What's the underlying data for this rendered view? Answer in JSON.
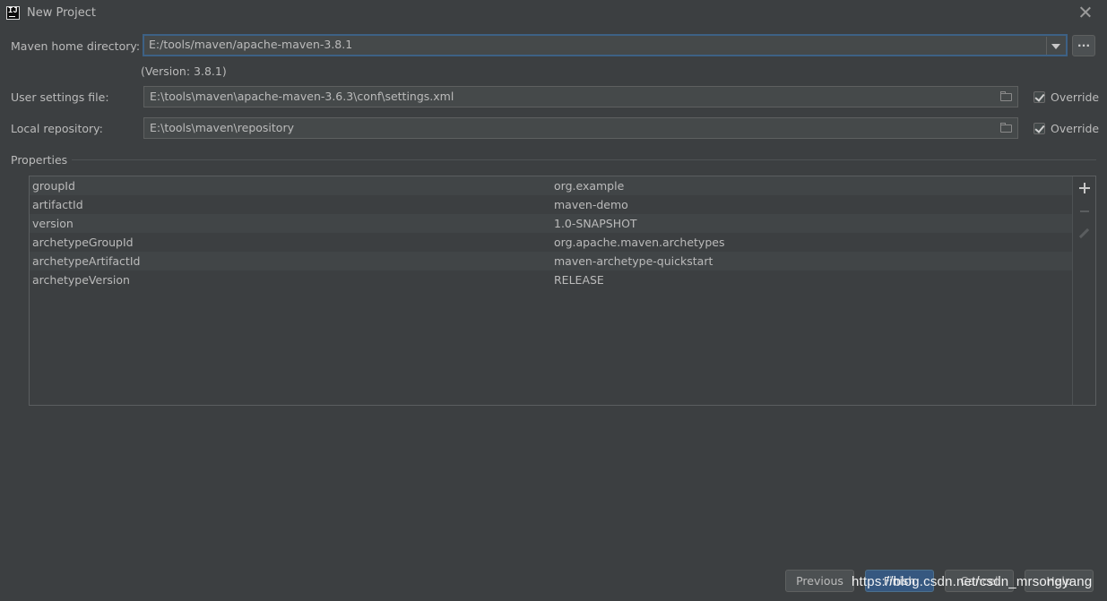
{
  "window": {
    "title": "New Project",
    "icon": "intellij-icon",
    "app_icon_text": "IJ"
  },
  "maven_home": {
    "label": "Maven home directory:",
    "value": "E:/tools/maven/apache-maven-3.8.1",
    "version_note": "(Version: 3.8.1)",
    "browse_label": "..."
  },
  "user_settings": {
    "label": "User settings file:",
    "value": "E:\\tools\\maven\\apache-maven-3.6.3\\conf\\settings.xml",
    "override_label": "Override",
    "override_checked": true
  },
  "local_repository": {
    "label": "Local repository:",
    "value": "E:\\tools\\maven\\repository",
    "override_label": "Override",
    "override_checked": true
  },
  "properties": {
    "header": "Properties",
    "rows": [
      {
        "key": "groupId",
        "value": "org.example"
      },
      {
        "key": "artifactId",
        "value": "maven-demo"
      },
      {
        "key": "version",
        "value": "1.0-SNAPSHOT"
      },
      {
        "key": "archetypeGroupId",
        "value": "org.apache.maven.archetypes"
      },
      {
        "key": "archetypeArtifactId",
        "value": "maven-archetype-quickstart"
      },
      {
        "key": "archetypeVersion",
        "value": "RELEASE"
      }
    ]
  },
  "buttons": {
    "previous": "Previous",
    "finish": "Finish",
    "cancel": "Cancel",
    "help": "Help"
  },
  "watermark": "https://blog.csdn.net/csdn_mrsongyang",
  "colors": {
    "background": "#3c3f41",
    "field_bg": "#45494a",
    "focus_border": "#3d6185",
    "primary_button": "#365880",
    "text": "#bbbbbb"
  }
}
